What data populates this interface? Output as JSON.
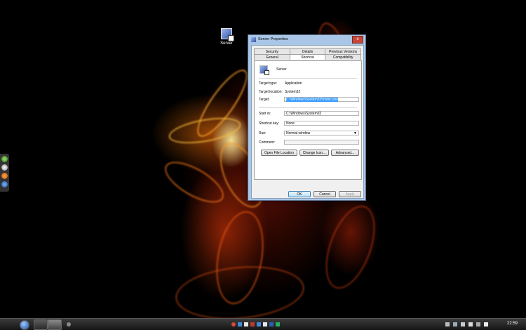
{
  "desktop": {
    "icon_label": "Server"
  },
  "dialog": {
    "title": "Server Properties",
    "close_glyph": "x",
    "tabs_row1": [
      "Security",
      "Details",
      "Previous Versions"
    ],
    "tabs_row2": [
      "General",
      "Shortcut",
      "Compatibility"
    ],
    "selected_tab": "Shortcut",
    "shortcut_name": "Server",
    "fields": {
      "target_type_label": "Target type:",
      "target_type_value": "Application",
      "target_location_label": "Target location:",
      "target_location_value": "System32",
      "target_label": "Target:",
      "target_value": "C:\\Windows\\System32\\mstsc.exe",
      "start_in_label": "Start in:",
      "start_in_value": "C:\\Windows\\System32",
      "shortcut_key_label": "Shortcut key:",
      "shortcut_key_value": "None",
      "run_label": "Run:",
      "run_value": "Normal window",
      "comment_label": "Comment:",
      "comment_value": ""
    },
    "buttons": {
      "open_file_location": "Open File Location",
      "change_icon": "Change Icon...",
      "advanced": "Advanced...",
      "ok": "OK",
      "cancel": "Cancel",
      "apply": "Apply"
    }
  },
  "taskbar": {
    "clock": "22:59"
  },
  "colors": {
    "selection": "#3399ff",
    "dialog_frame": "#a9c6e6",
    "close_button": "#c8463a"
  }
}
